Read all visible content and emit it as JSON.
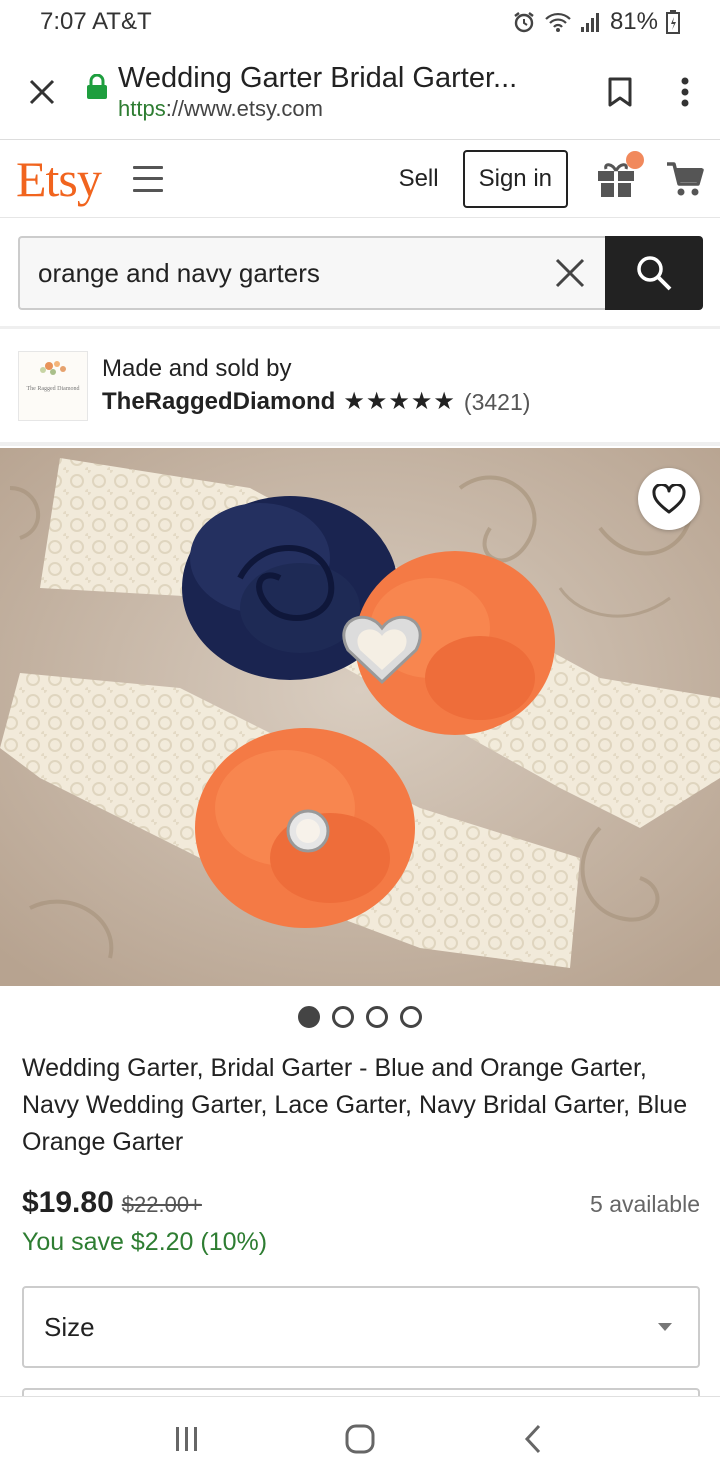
{
  "status_bar": {
    "time": "7:07",
    "carrier": "AT&T",
    "battery": "81%"
  },
  "browser": {
    "page_title": "Wedding Garter Bridal Garter...",
    "url_scheme": "https",
    "url_rest": "://www.etsy.com"
  },
  "header": {
    "logo": "Etsy",
    "sell": "Sell",
    "sign_in": "Sign in"
  },
  "search": {
    "query": "orange and navy garters"
  },
  "shop": {
    "made_by": "Made and sold by",
    "name": "TheRaggedDiamond",
    "stars": "★★★★★",
    "review_count": "(3421)",
    "logo_text": "The Ragged Diamond"
  },
  "carousel": {
    "total": 4,
    "active": 1
  },
  "product": {
    "title": "Wedding Garter, Bridal Garter - Blue and Orange Garter, Navy Wedding Garter, Lace Garter, Navy Bridal Garter, Blue Orange Garter",
    "price": "$19.80",
    "original_price": "$22.00+",
    "availability": "5 available",
    "savings": "You save $2.20 (10%)"
  },
  "options": {
    "size_label": "Size"
  },
  "colors": {
    "etsy_orange": "#f1641e",
    "savings_green": "#2e7d32",
    "navy_flower": "#1e2a55",
    "orange_flower": "#f47a45"
  }
}
